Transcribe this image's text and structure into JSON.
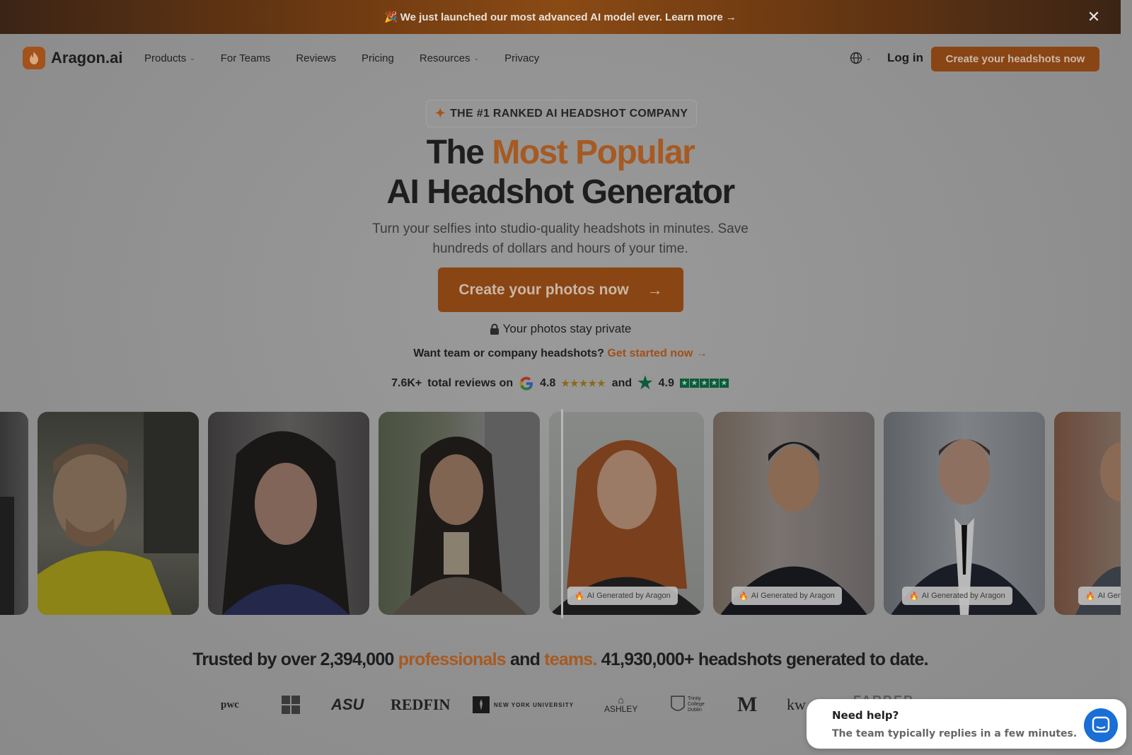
{
  "banner": {
    "emoji": "🎉",
    "text": "We just launched our most advanced AI model ever. Learn more →"
  },
  "nav": {
    "logo_text": "Aragon.ai",
    "items": [
      {
        "label": "Products",
        "dropdown": true
      },
      {
        "label": "For Teams",
        "dropdown": false
      },
      {
        "label": "Reviews",
        "dropdown": false
      },
      {
        "label": "Pricing",
        "dropdown": false
      },
      {
        "label": "Resources",
        "dropdown": true
      },
      {
        "label": "Privacy",
        "dropdown": false
      }
    ],
    "login": "Log in",
    "cta": "Create your headshots now"
  },
  "hero": {
    "badge": "THE #1 RANKED AI HEADSHOT COMPANY",
    "title_prefix": "The ",
    "title_accent": "Most Popular",
    "title_line2": "AI Headshot Generator",
    "subtitle": "Turn your selfies into studio-quality headshots in minutes. Save hundreds of dollars and hours of your time.",
    "cta": "Create your photos now",
    "private_note": "Your photos stay private",
    "team_question": "Want team or company headshots?",
    "team_link": "Get started now →"
  },
  "reviews": {
    "count": "7.6K+",
    "label": "total reviews on",
    "google_rating": "4.8",
    "and": "and",
    "trustpilot_rating": "4.9"
  },
  "photos": {
    "ai_tag": "AI Generated by Aragon",
    "ai_tag_partial": "AI Gene"
  },
  "trusted": {
    "p1": "Trusted by over 2,394,000 ",
    "accent1": "professionals",
    "p2": " and ",
    "accent2": "teams.",
    "p3": " 41,930,000+ headshots generated to date."
  },
  "logos": {
    "pwc": "pwc",
    "asu": "ASU",
    "redfin": "REDFIN",
    "nyu": "NEW YORK UNIVERSITY",
    "ashley": "ASHLEY",
    "trinity": "Trinity College Dublin",
    "michigan": "M",
    "kw": "kw",
    "farber": "FARBER"
  },
  "chat": {
    "title": "Need help?",
    "subtitle": "The team typically replies in a few minutes."
  },
  "colors": {
    "accent": "#a65a22",
    "cta_bg": "#8a4514",
    "chat_button": "#1a6fd6"
  }
}
